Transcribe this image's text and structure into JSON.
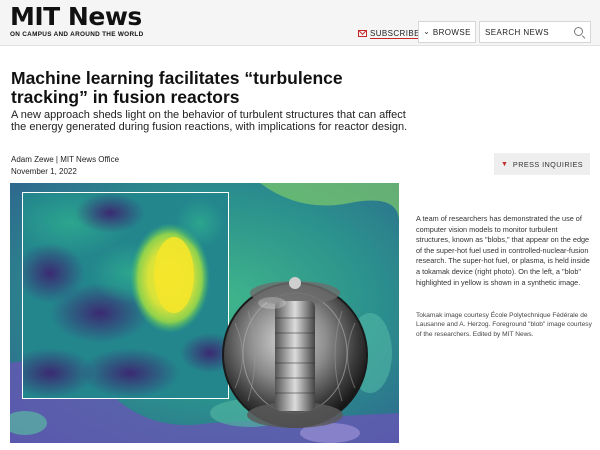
{
  "site": {
    "title": "MIT News",
    "tagline": "ON CAMPUS AND AROUND THE WORLD"
  },
  "header": {
    "subscribe_label": "SUBSCRIBE",
    "browse_label": "BROWSE",
    "search_placeholder": "SEARCH NEWS"
  },
  "article": {
    "headline": "Machine learning facilitates “turbulence tracking” in fusion reactors",
    "subhead": "A new approach sheds light on the behavior of turbulent structures that can affect the energy generated during fusion reactions, with implications for reactor design.",
    "author": "Adam Zewe | MIT News Office",
    "date": "November 1, 2022",
    "press_label": "PRESS INQUIRIES"
  },
  "image": {
    "caption": "A team of researchers has demonstrated the use of computer vision models to monitor turbulent structures, known as \"blobs,\" that appear on the edge of the super-hot fuel used in controlled-nuclear-fusion research. The super-hot fuel, or plasma, is held inside a tokamak device (right photo). On the left, a \"blob\" highlighted in yellow is shown in a synthetic image.",
    "credit": "Tokamak image courtesy École Polytechnique Fédérale de Lausanne and A. Herzog. Foreground \"blob\" image courtesy of the researchers. Edited by MIT News."
  },
  "colors": {
    "accent": "#c62828",
    "header_bg": "#f5f5f5",
    "heatmap_bg": "#1f7f8a",
    "blob_yellow": "#f1e428"
  },
  "icons": {
    "subscribe": "mail-icon",
    "browse": "chevron-down-icon",
    "search": "search-icon",
    "press": "chevron-down-icon"
  }
}
